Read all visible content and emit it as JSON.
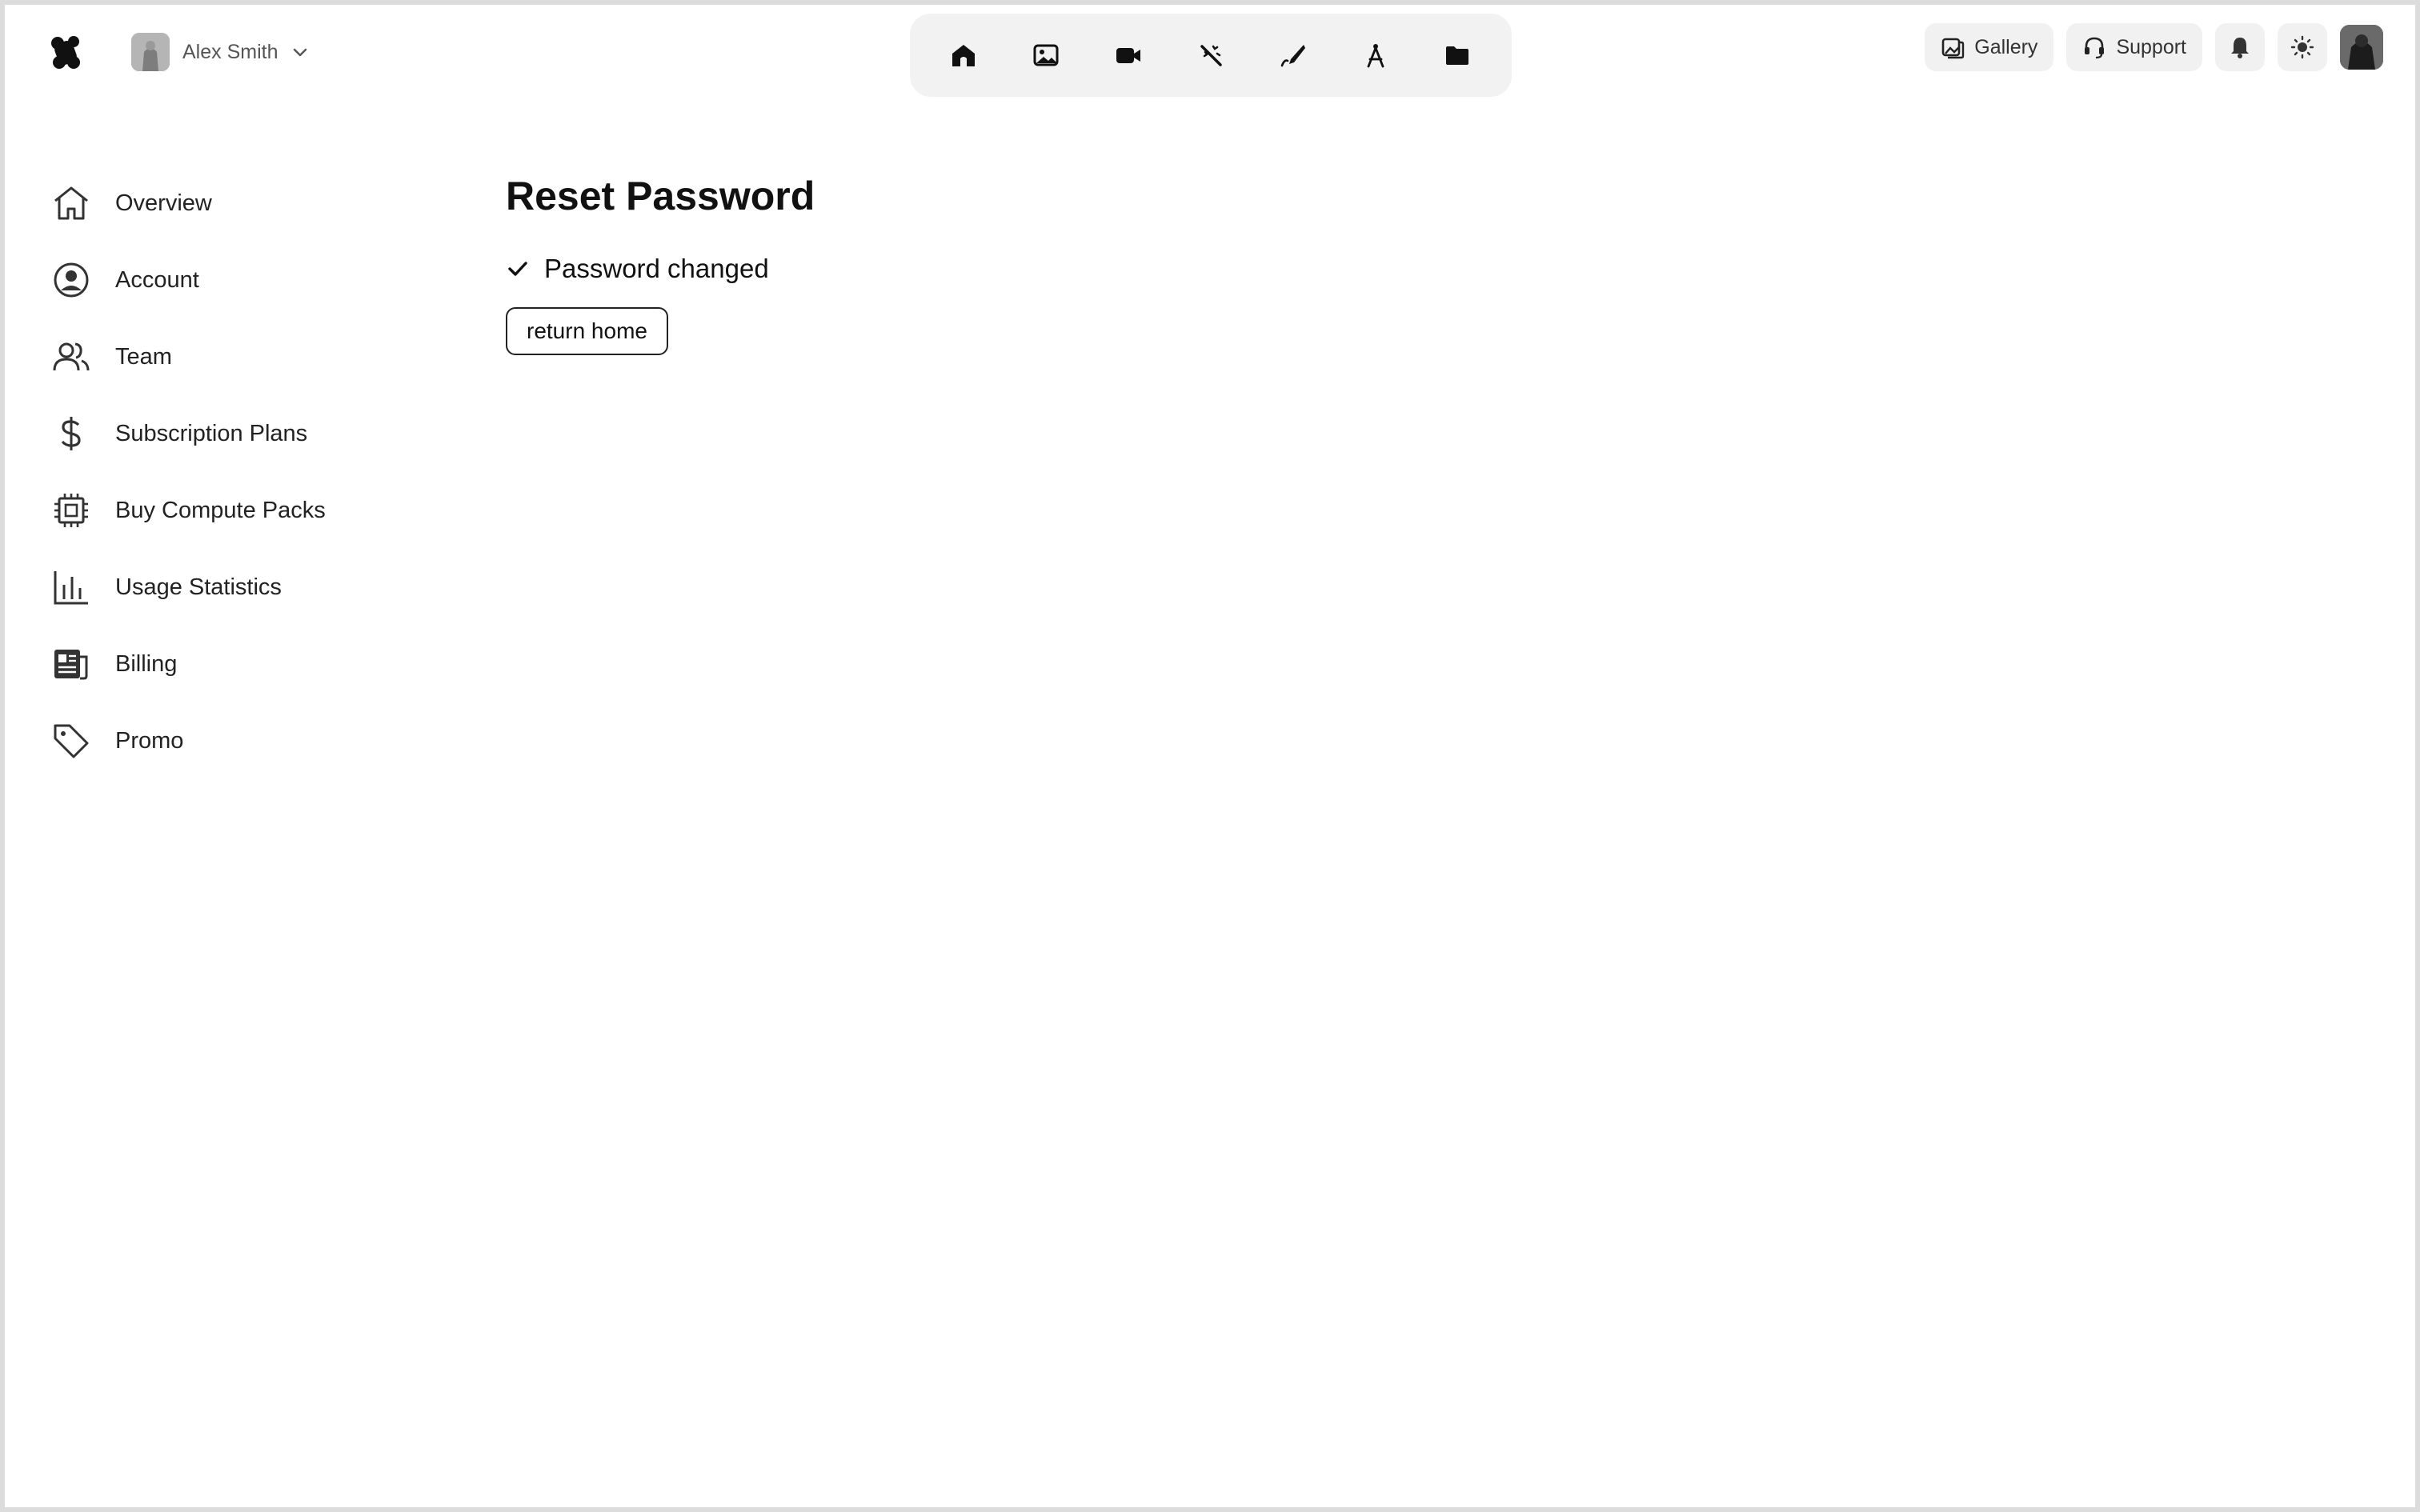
{
  "app": {
    "user_name": "Alex Smith"
  },
  "toolbar": {
    "tools": [
      {
        "icon": "home-icon"
      },
      {
        "icon": "image-icon"
      },
      {
        "icon": "video-icon"
      },
      {
        "icon": "magic-wand-icon"
      },
      {
        "icon": "brush-icon"
      },
      {
        "icon": "compass-icon"
      },
      {
        "icon": "folder-icon"
      }
    ]
  },
  "header": {
    "gallery_label": "Gallery",
    "support_label": "Support",
    "icons": [
      "bell-icon",
      "sun-icon"
    ]
  },
  "sidebar": {
    "items": [
      {
        "label": "Overview",
        "icon": "home-outline-icon"
      },
      {
        "label": "Account",
        "icon": "user-circle-icon"
      },
      {
        "label": "Team",
        "icon": "users-icon"
      },
      {
        "label": "Subscription Plans",
        "icon": "dollar-icon"
      },
      {
        "label": "Buy Compute Packs",
        "icon": "cpu-icon"
      },
      {
        "label": "Usage Statistics",
        "icon": "bar-chart-icon"
      },
      {
        "label": "Billing",
        "icon": "receipt-icon"
      },
      {
        "label": "Promo",
        "icon": "tag-icon"
      }
    ]
  },
  "main": {
    "title": "Reset Password",
    "status_text": "Password changed",
    "return_button": "return home"
  },
  "colors": {
    "background": "#ffffff",
    "toolbar_bg": "#f2f2f2",
    "text": "#1a1a1a"
  }
}
